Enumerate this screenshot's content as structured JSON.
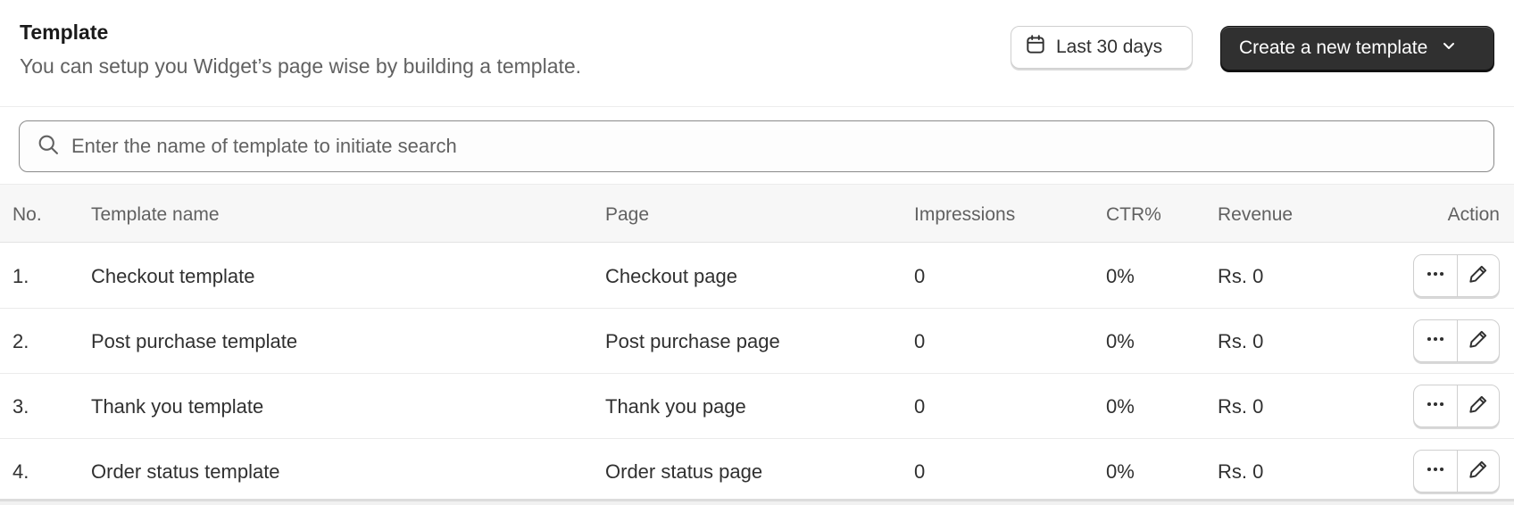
{
  "header": {
    "title": "Template",
    "subtitle": "You can setup you Widget’s page wise by building a template.",
    "date_range_label": "Last 30 days",
    "create_label": "Create a new template"
  },
  "search": {
    "placeholder": "Enter the name of template to initiate search",
    "value": ""
  },
  "table": {
    "columns": {
      "no": "No.",
      "name": "Template name",
      "page": "Page",
      "impressions": "Impressions",
      "ctr": "CTR%",
      "revenue": "Revenue",
      "action": "Action"
    },
    "rows": [
      {
        "no": "1.",
        "name": "Checkout template",
        "page": "Checkout page",
        "impressions": "0",
        "ctr": "0%",
        "revenue": "Rs. 0"
      },
      {
        "no": "2.",
        "name": "Post purchase template",
        "page": "Post purchase page",
        "impressions": "0",
        "ctr": "0%",
        "revenue": "Rs. 0"
      },
      {
        "no": "3.",
        "name": "Thank you template",
        "page": "Thank you page",
        "impressions": "0",
        "ctr": "0%",
        "revenue": "Rs. 0"
      },
      {
        "no": "4.",
        "name": "Order status template",
        "page": "Order status page",
        "impressions": "0",
        "ctr": "0%",
        "revenue": "Rs. 0"
      }
    ]
  },
  "icons": {
    "calendar": "calendar-icon",
    "chevron": "chevron-down-icon",
    "search": "search-icon",
    "more": "more-horizontal-icon",
    "edit": "edit-pencil-icon"
  },
  "colors": {
    "primary_button": "#303030",
    "text": "#303030",
    "muted_text": "#616161",
    "header_bg": "#f7f7f7"
  }
}
